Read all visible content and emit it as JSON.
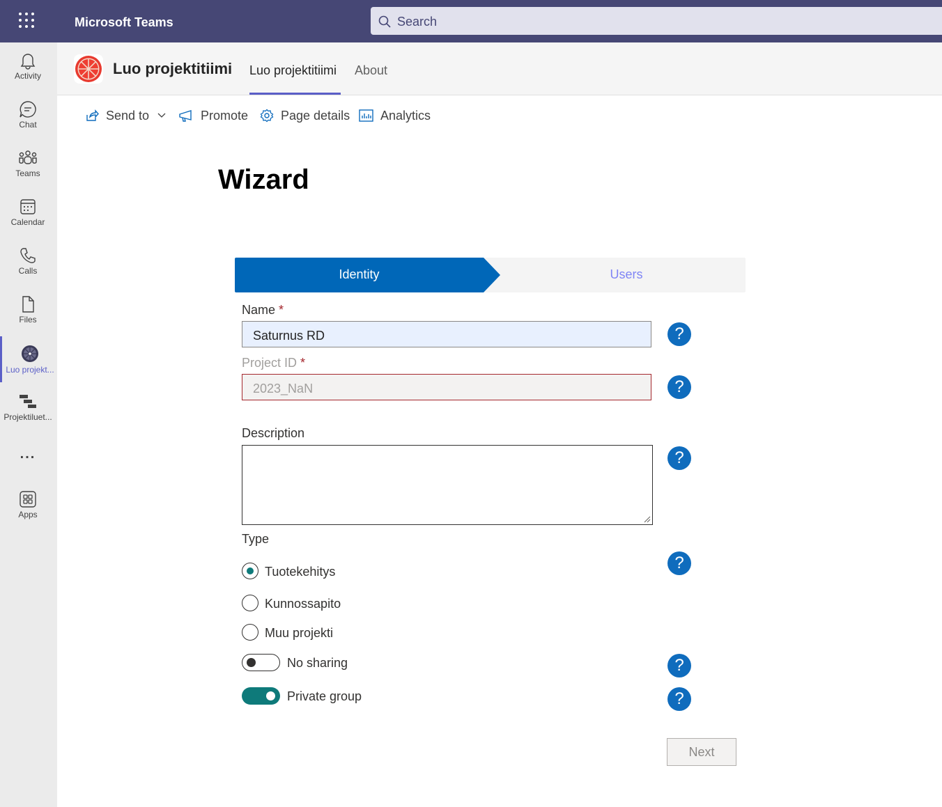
{
  "topbar": {
    "app_title": "Microsoft Teams",
    "search_placeholder": "Search",
    "bg_color": "#464775"
  },
  "rail": {
    "items": [
      {
        "label": "Activity",
        "icon": "bell-icon"
      },
      {
        "label": "Chat",
        "icon": "chat-icon"
      },
      {
        "label": "Teams",
        "icon": "teams-icon"
      },
      {
        "label": "Calendar",
        "icon": "calendar-icon"
      },
      {
        "label": "Calls",
        "icon": "phone-icon"
      },
      {
        "label": "Files",
        "icon": "file-icon"
      },
      {
        "label": "Luo projekt...",
        "icon": "orange-slice-icon",
        "active": true
      },
      {
        "label": "Projektiluet...",
        "icon": "gantt-icon"
      },
      {
        "label": "...",
        "icon": "more-icon"
      },
      {
        "label": "Apps",
        "icon": "apps-icon"
      }
    ]
  },
  "app_header": {
    "title": "Luo projektitiimi",
    "tabs": [
      {
        "label": "Luo projektitiimi",
        "active": true
      },
      {
        "label": "About",
        "active": false
      }
    ]
  },
  "commands": {
    "send_to": "Send to",
    "promote": "Promote",
    "page_details": "Page details",
    "analytics": "Analytics"
  },
  "wizard": {
    "title": "Wizard",
    "steps": {
      "identity": "Identity",
      "users": "Users"
    },
    "name_label": "Name",
    "name_value": "Saturnus RD",
    "project_id_label": "Project ID",
    "project_id_value": "2023_NaN",
    "required_mark": "*",
    "description_label": "Description",
    "type_label": "Type",
    "type_options": [
      {
        "label": "Tuotekehitys",
        "checked": true
      },
      {
        "label": "Kunnossapito",
        "checked": false
      },
      {
        "label": "Muu projekti",
        "checked": false
      }
    ],
    "no_sharing_label": "No sharing",
    "no_sharing_on": false,
    "private_group_label": "Private group",
    "private_group_on": true,
    "help_glyph": "?",
    "next_label": "Next"
  },
  "colors": {
    "accent": "#5b5fc7",
    "step_active": "#0067b8",
    "help": "#0f6cbd",
    "toggle_on": "#0e7a7a",
    "error_border": "#a4262c"
  }
}
